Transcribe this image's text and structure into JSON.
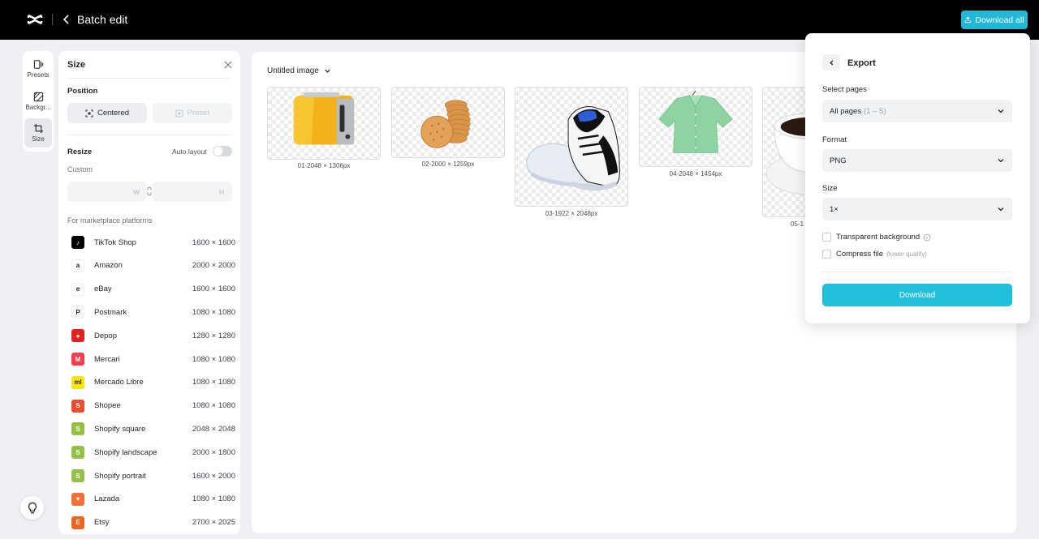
{
  "header": {
    "title": "Batch edit",
    "download_all": "Download all"
  },
  "rail": [
    {
      "label": "Presets",
      "icon": "presets-icon"
    },
    {
      "label": "Backgr...",
      "icon": "background-icon"
    },
    {
      "label": "Size",
      "icon": "crop-icon",
      "active": true
    }
  ],
  "size_panel": {
    "title": "Size",
    "position_label": "Position",
    "centered": "Centered",
    "preset": "Preset",
    "resize_label": "Resize",
    "auto_layout": "Auto layout",
    "custom": "Custom",
    "w_suffix": "W",
    "h_suffix": "H",
    "marketplace_label": "For marketplace platforms",
    "platforms": [
      {
        "name": "TikTok Shop",
        "size": "1600 × 1600",
        "color": "#000000",
        "glyph": "♪"
      },
      {
        "name": "Amazon",
        "size": "2000 × 2000",
        "color": "#ffffff",
        "glyph": "a"
      },
      {
        "name": "eBay",
        "size": "1600 × 1600",
        "color": "#ffffff",
        "glyph": "e"
      },
      {
        "name": "Postmark",
        "size": "1080 × 1080",
        "color": "#ffffff",
        "glyph": "P"
      },
      {
        "name": "Depop",
        "size": "1280 × 1280",
        "color": "#e0211d",
        "glyph": "●"
      },
      {
        "name": "Mercari",
        "size": "1080 × 1080",
        "color": "#ff3b4c",
        "glyph": "M"
      },
      {
        "name": "Mercado Libre",
        "size": "1080 × 1080",
        "color": "#ffe600",
        "glyph": "ml"
      },
      {
        "name": "Shopee",
        "size": "1080 × 1080",
        "color": "#ee4d2d",
        "glyph": "S"
      },
      {
        "name": "Shopify square",
        "size": "2048 × 2048",
        "color": "#95bf47",
        "glyph": "S"
      },
      {
        "name": "Shopify landscape",
        "size": "2000 × 1800",
        "color": "#95bf47",
        "glyph": "S"
      },
      {
        "name": "Shopify portrait",
        "size": "1600 × 2000",
        "color": "#95bf47",
        "glyph": "S"
      },
      {
        "name": "Lazada",
        "size": "1080 × 1080",
        "color": "#f36f36",
        "glyph": "♥"
      },
      {
        "name": "Etsy",
        "size": "2700 × 2025",
        "color": "#f1641e",
        "glyph": "E"
      }
    ]
  },
  "canvas": {
    "doc_title": "Untitled image",
    "images": [
      {
        "caption": "01-2048 × 1306px",
        "subject": "toaster"
      },
      {
        "caption": "02-2000 × 1259px",
        "subject": "biscuits"
      },
      {
        "caption": "03-1922 × 2048px",
        "subject": "sneaker"
      },
      {
        "caption": "04-2048 × 1454px",
        "subject": "shirt"
      },
      {
        "caption": "05-1",
        "subject": "coffee-cup"
      }
    ]
  },
  "export": {
    "title": "Export",
    "select_pages_label": "Select pages",
    "pages_value": "All pages",
    "pages_range": "(1 – 5)",
    "format_label": "Format",
    "format_value": "PNG",
    "size_label": "Size",
    "size_value": "1×",
    "transparent_bg": "Transparent background",
    "compress": "Compress file",
    "compress_hint": "(lower quality)",
    "download": "Download"
  },
  "colors": {
    "accent": "#22bfdc",
    "topbar": "#000000"
  }
}
